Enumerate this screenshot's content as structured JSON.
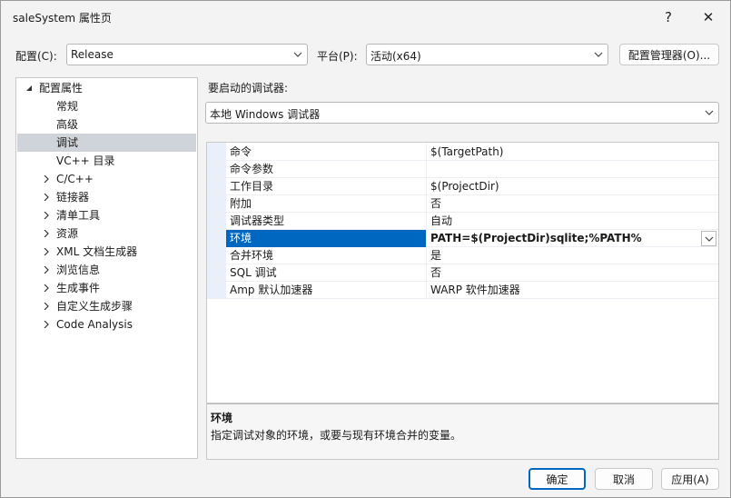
{
  "window": {
    "title": "saleSystem 属性页",
    "help_glyph": "?",
    "close_glyph": "✕"
  },
  "config": {
    "label": "配置(C):",
    "value": "Release"
  },
  "platform": {
    "label": "平台(P):",
    "value": "活动(x64)"
  },
  "config_manager_button": "配置管理器(O)...",
  "tree": {
    "root": "配置属性",
    "items": [
      {
        "label": "常规",
        "expandable": false
      },
      {
        "label": "高级",
        "expandable": false
      },
      {
        "label": "调试",
        "expandable": false,
        "selected": true
      },
      {
        "label": "VC++ 目录",
        "expandable": false
      },
      {
        "label": "C/C++",
        "expandable": true
      },
      {
        "label": "链接器",
        "expandable": true
      },
      {
        "label": "清单工具",
        "expandable": true
      },
      {
        "label": "资源",
        "expandable": true
      },
      {
        "label": "XML 文档生成器",
        "expandable": true
      },
      {
        "label": "浏览信息",
        "expandable": true
      },
      {
        "label": "生成事件",
        "expandable": true
      },
      {
        "label": "自定义生成步骤",
        "expandable": true
      },
      {
        "label": "Code Analysis",
        "expandable": true
      }
    ]
  },
  "debugger": {
    "label": "要启动的调试器:",
    "value": "本地 Windows 调试器"
  },
  "properties": [
    {
      "name": "命令",
      "value": "$(TargetPath)"
    },
    {
      "name": "命令参数",
      "value": ""
    },
    {
      "name": "工作目录",
      "value": "$(ProjectDir)"
    },
    {
      "name": "附加",
      "value": "否"
    },
    {
      "name": "调试器类型",
      "value": "自动"
    },
    {
      "name": "环境",
      "value": "PATH=$(ProjectDir)sqlite;%PATH%",
      "selected": true
    },
    {
      "name": "合并环境",
      "value": "是"
    },
    {
      "name": "SQL 调试",
      "value": "否"
    },
    {
      "name": "Amp 默认加速器",
      "value": "WARP 软件加速器"
    }
  ],
  "description": {
    "title": "环境",
    "text": "指定调试对象的环境，或要与现有环境合并的变量。"
  },
  "footer": {
    "ok": "确定",
    "cancel": "取消",
    "apply": "应用(A)"
  },
  "colors": {
    "accent": "#0067c0",
    "tree_selection": "#cfd3da"
  }
}
